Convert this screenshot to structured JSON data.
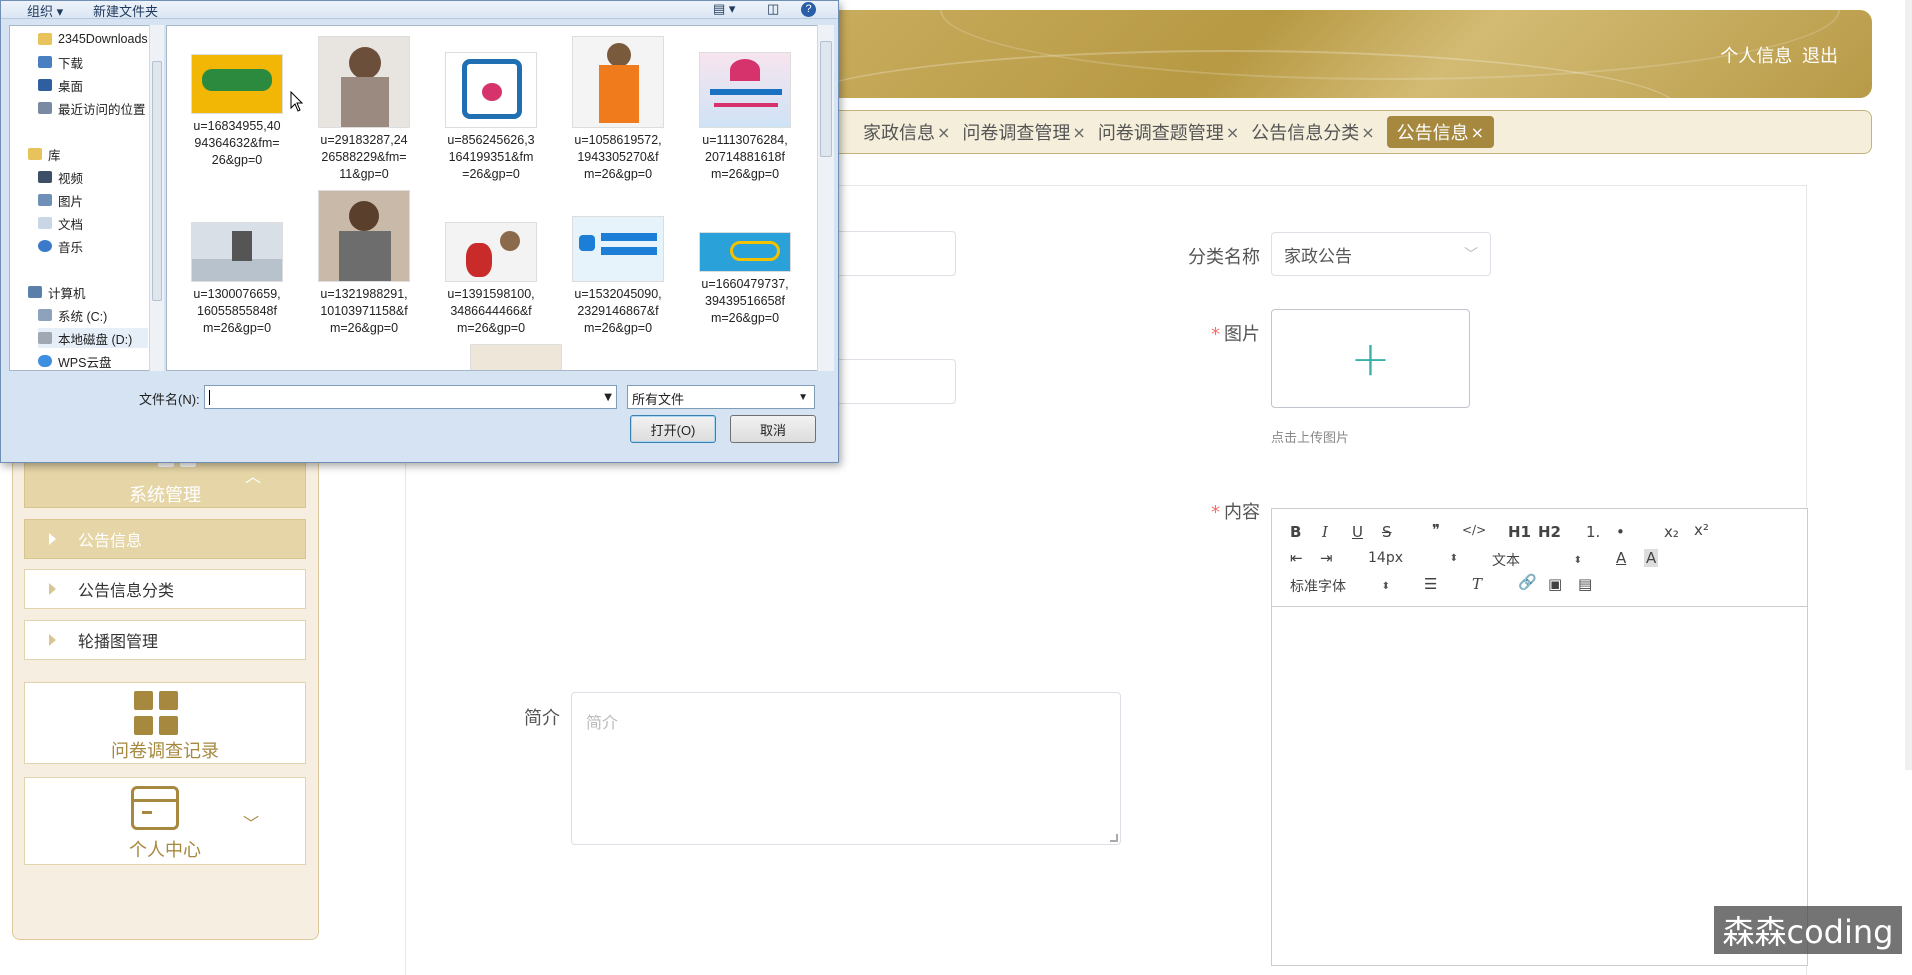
{
  "header": {
    "profile_link": "个人信息",
    "logout_link": "退出"
  },
  "tabs": [
    {
      "label": "家政信息"
    },
    {
      "label": "问卷调查管理"
    },
    {
      "label": "问卷调查题管理"
    },
    {
      "label": "公告信息分类"
    },
    {
      "label": "公告信息"
    }
  ],
  "tab_close_glyph": "×",
  "sidebar": {
    "system_menu_label": "系统管理",
    "subitems": [
      {
        "label": "公告信息",
        "active": true
      },
      {
        "label": "公告信息分类",
        "active": false
      },
      {
        "label": "轮播图管理",
        "active": false
      }
    ],
    "survey_label": "问卷调查记录",
    "personal_label": "个人中心"
  },
  "form": {
    "category_label": "分类名称",
    "category_value": "家政公告",
    "image_label": "图片",
    "upload_tip": "点击上传图片",
    "content_label": "内容",
    "summary_label": "简介",
    "summary_placeholder": "简介",
    "required_mark": "*"
  },
  "editor": {
    "font_size": "14px",
    "block_type": "文本",
    "font_family": "标准字体",
    "buttons": [
      "B",
      "I",
      "U",
      "S",
      "❞",
      "</>",
      "H1",
      "H2",
      "1.",
      "•",
      "x₂",
      "x²"
    ]
  },
  "dialog": {
    "toolbar": {
      "organize": "组织 ▾",
      "new_folder": "新建文件夹"
    },
    "nav_items": [
      {
        "label": "2345Downloads",
        "icon": "folder-icon"
      },
      {
        "label": "下载",
        "icon": "download-folder-icon"
      },
      {
        "label": "桌面",
        "icon": "desktop-icon"
      },
      {
        "label": "最近访问的位置",
        "icon": "recent-places-icon"
      },
      {
        "label": "库",
        "icon": "library-icon"
      },
      {
        "label": "视频",
        "icon": "video-icon"
      },
      {
        "label": "图片",
        "icon": "picture-icon"
      },
      {
        "label": "文档",
        "icon": "document-icon"
      },
      {
        "label": "音乐",
        "icon": "music-icon"
      },
      {
        "label": "计算机",
        "icon": "computer-icon"
      },
      {
        "label": "系统 (C:)",
        "icon": "drive-c-icon"
      },
      {
        "label": "本地磁盘 (D:)",
        "icon": "drive-d-icon"
      },
      {
        "label": "WPS云盘",
        "icon": "cloud-icon"
      }
    ],
    "files": [
      {
        "name_l1": "u=16834955,40",
        "name_l2": "94364632&fm=",
        "name_l3": "26&gp=0",
        "thumb_color": "#f2b705",
        "accent": "#2b8a3e"
      },
      {
        "name_l1": "u=29183287,24",
        "name_l2": "26588229&fm=",
        "name_l3": "11&gp=0",
        "thumb_color": "#e8e4e0",
        "accent": "#6b4f3a"
      },
      {
        "name_l1": "u=856245626,3",
        "name_l2": "164199351&fm",
        "name_l3": "=26&gp=0",
        "thumb_color": "#ffffff",
        "accent": "#1f6fb2"
      },
      {
        "name_l1": "u=1058619572,",
        "name_l2": "1943305270&f",
        "name_l3": "m=26&gp=0",
        "thumb_color": "#f4f4f4",
        "accent": "#f07b1d"
      },
      {
        "name_l1": "u=1113076284,",
        "name_l2": "20714881618f",
        "name_l3": "m=26&gp=0",
        "thumb_color": "#f7e4ef",
        "accent": "#d6336c"
      },
      {
        "name_l1": "u=1300076659,",
        "name_l2": "16055855848f",
        "name_l3": "m=26&gp=0",
        "thumb_color": "#d9dfe6",
        "accent": "#555555"
      },
      {
        "name_l1": "u=1321988291,",
        "name_l2": "10103971158&f",
        "name_l3": "m=26&gp=0",
        "thumb_color": "#c9b9a8",
        "accent": "#6d6d6d"
      },
      {
        "name_l1": "u=1391598100,",
        "name_l2": "3486644466&f",
        "name_l3": "m=26&gp=0",
        "thumb_color": "#f3f3f3",
        "accent": "#c92a2a"
      },
      {
        "name_l1": "u=1532045090,",
        "name_l2": "2329146867&f",
        "name_l3": "m=26&gp=0",
        "thumb_color": "#e7f3fb",
        "accent": "#1c7ed6"
      },
      {
        "name_l1": "u=1660479737,",
        "name_l2": "39439516658f",
        "name_l3": "m=26&gp=0",
        "thumb_color": "#2aa1d8",
        "accent": "#f2c200"
      }
    ],
    "filename_label": "文件名(N):",
    "filename_value": "",
    "filetype_value": "所有文件",
    "open_button": "打开(O)",
    "cancel_button": "取消"
  },
  "watermark": "森森coding",
  "colors": {
    "accent": "#a6883f",
    "header": "#b79943",
    "teal_plus": "#38b2a8"
  }
}
